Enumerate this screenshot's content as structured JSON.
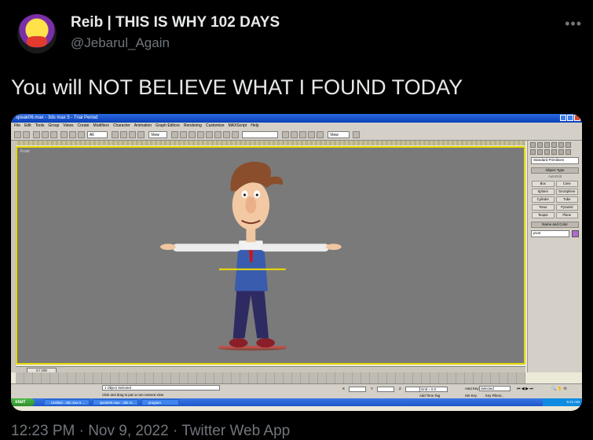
{
  "tweet": {
    "display_name": "Reib | THIS IS WHY 102 DAYS",
    "handle": "@Jebarul_Again",
    "more_label": "•••",
    "text": "You will NOT BELIEVE WHAT I FOUND TODAY",
    "timestamp": "12:23 PM · Nov 9, 2022 · Twitter Web App"
  },
  "screenshot": {
    "window_title": "speak06.max - 3ds max 5 - Trial Period",
    "menu": [
      "File",
      "Edit",
      "Tools",
      "Group",
      "Views",
      "Create",
      "Modifiers",
      "Character",
      "Animation",
      "Graph Editors",
      "Rendering",
      "Customize",
      "MAXScript",
      "Help"
    ],
    "toolbar": {
      "selection_filter": "All",
      "ref_coord": "View",
      "named_sel": "",
      "render_type": "View"
    },
    "viewport_label": "Front",
    "command_panel": {
      "category": "Standard Primitives",
      "object_type_title": "Object Type",
      "autogrid": "AutoGrid",
      "buttons": [
        "Box",
        "Cone",
        "Sphere",
        "GeoSphere",
        "Cylinder",
        "Tube",
        "Torus",
        "Pyramid",
        "Teapot",
        "Plane"
      ],
      "name_color_title": "Name and Color",
      "name_value": "pivot"
    },
    "time_slider": "0 / 100",
    "status": {
      "selection": "1 Object Selected",
      "prompt": "Click and drag to pan a non-camera view",
      "x_label": "X",
      "y_label": "Y",
      "z_label": "Z",
      "grid": "Grid = 0.0",
      "add_time_tag": "Add Time Tag",
      "auto_key": "Auto Key",
      "set_key": "Set Key",
      "selected": "Selected",
      "key_filters": "Key Filters..."
    },
    "taskbar": {
      "start": "start",
      "tasks": [
        "Untitled - 3ds max 5 ...",
        "speak06.max - 3ds m...",
        "program"
      ],
      "clock": "5:21 AM"
    }
  }
}
